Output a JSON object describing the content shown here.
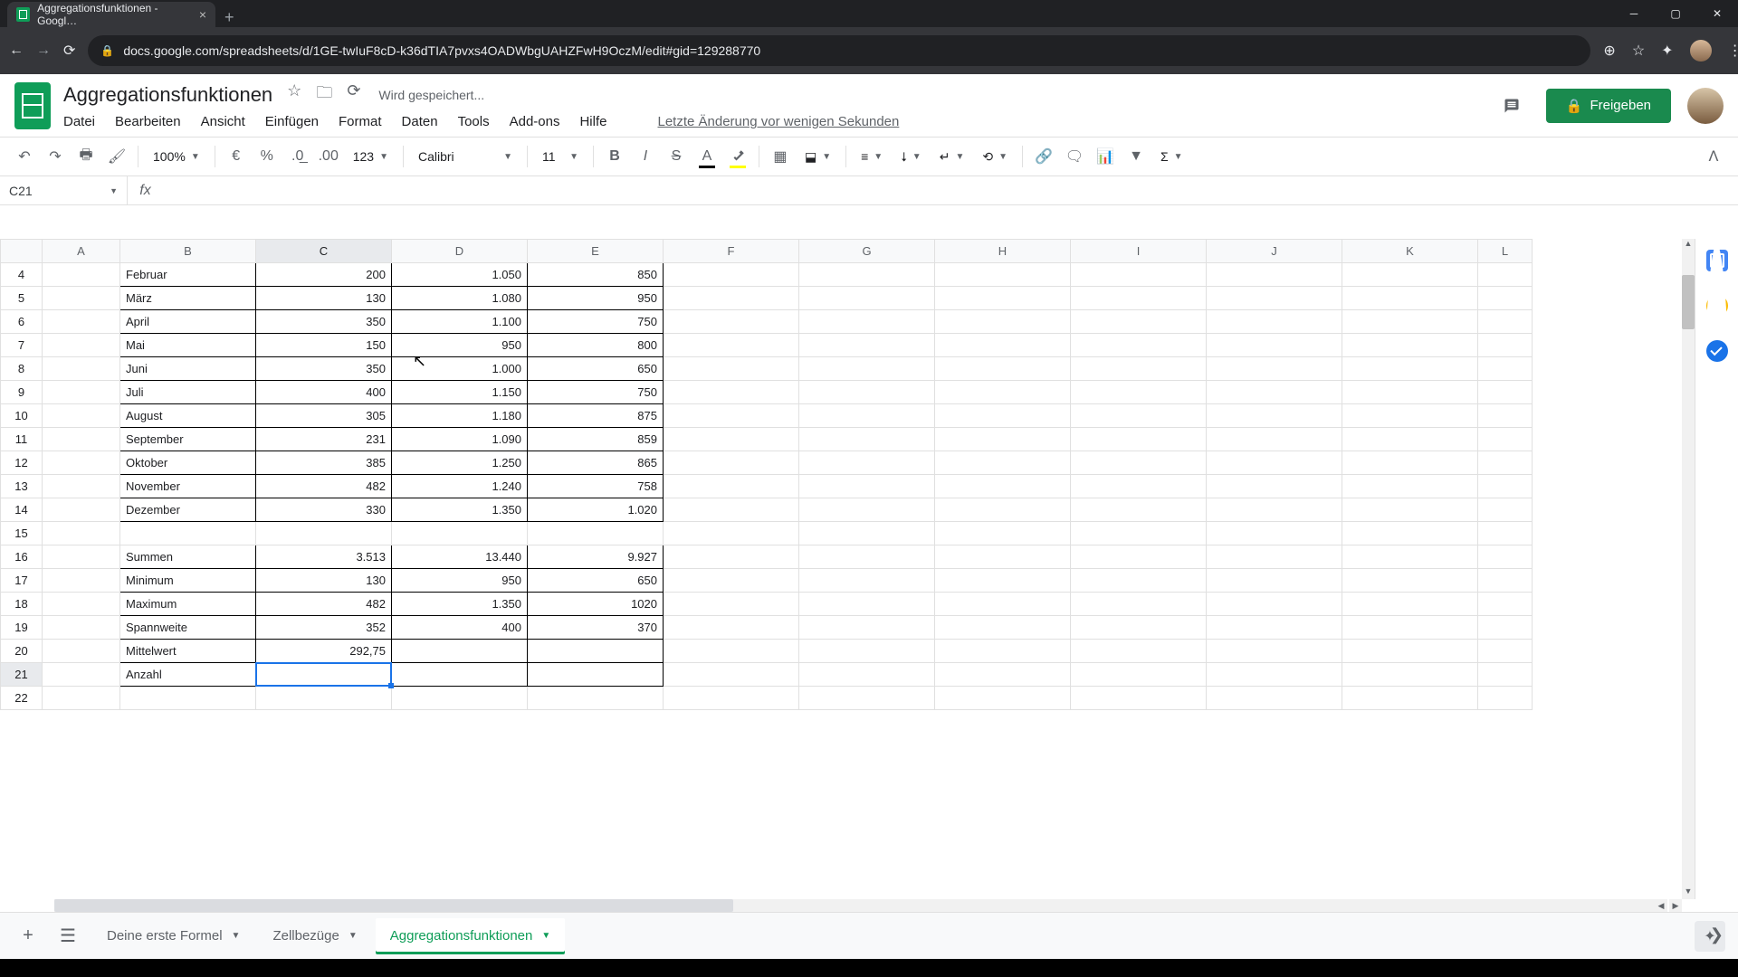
{
  "browser": {
    "tab_title": "Aggregationsfunktionen - Googl…",
    "url": "docs.google.com/spreadsheets/d/1GE-twIuF8cD-k36dTIA7pvxs4OADWbgUAHZFwH9OczM/edit#gid=129288770"
  },
  "doc": {
    "title": "Aggregationsfunktionen",
    "saving": "Wird gespeichert...",
    "last_edit": "Letzte Änderung vor wenigen Sekunden"
  },
  "menus": {
    "file": "Datei",
    "edit": "Bearbeiten",
    "view": "Ansicht",
    "insert": "Einfügen",
    "format": "Format",
    "data": "Daten",
    "tools": "Tools",
    "addons": "Add-ons",
    "help": "Hilfe"
  },
  "share": {
    "label": "Freigeben"
  },
  "toolbar": {
    "zoom": "100%",
    "currency": "€",
    "percent": "%",
    "dec_dec": ".0",
    "inc_dec": ".00",
    "more_formats": "123",
    "font": "Calibri",
    "font_size": "11"
  },
  "namebox": "C21",
  "formula": "",
  "columns": [
    "A",
    "B",
    "C",
    "D",
    "E",
    "F",
    "G",
    "H",
    "I",
    "J",
    "K",
    "L"
  ],
  "rows": [
    {
      "n": 4,
      "b": "Februar",
      "c": "200",
      "d": "1.050",
      "e": "850",
      "border": true
    },
    {
      "n": 5,
      "b": "März",
      "c": "130",
      "d": "1.080",
      "e": "950",
      "border": true
    },
    {
      "n": 6,
      "b": "April",
      "c": "350",
      "d": "1.100",
      "e": "750",
      "border": true
    },
    {
      "n": 7,
      "b": "Mai",
      "c": "150",
      "d": "950",
      "e": "800",
      "border": true
    },
    {
      "n": 8,
      "b": "Juni",
      "c": "350",
      "d": "1.000",
      "e": "650",
      "border": true
    },
    {
      "n": 9,
      "b": "Juli",
      "c": "400",
      "d": "1.150",
      "e": "750",
      "border": true
    },
    {
      "n": 10,
      "b": "August",
      "c": "305",
      "d": "1.180",
      "e": "875",
      "border": true
    },
    {
      "n": 11,
      "b": "September",
      "c": "231",
      "d": "1.090",
      "e": "859",
      "border": true
    },
    {
      "n": 12,
      "b": "Oktober",
      "c": "385",
      "d": "1.250",
      "e": "865",
      "border": true
    },
    {
      "n": 13,
      "b": "November",
      "c": "482",
      "d": "1.240",
      "e": "758",
      "border": true
    },
    {
      "n": 14,
      "b": "Dezember",
      "c": "330",
      "d": "1.350",
      "e": "1.020",
      "border": true
    },
    {
      "n": 15
    },
    {
      "n": 16,
      "b": "Summen",
      "c": "3.513",
      "d": "13.440",
      "e": "9.927",
      "border": true,
      "yellow": true
    },
    {
      "n": 17,
      "b": "Minimum",
      "c": "130",
      "d": "950",
      "e": "650",
      "border": true,
      "yellow": true
    },
    {
      "n": 18,
      "b": "Maximum",
      "c": "482",
      "d": "1.350",
      "e": "1020",
      "border": true,
      "yellow": true
    },
    {
      "n": 19,
      "b": "Spannweite",
      "c": "352",
      "d": "400",
      "e": "370",
      "border": true,
      "yellow": true
    },
    {
      "n": 20,
      "b": "Mittelwert",
      "c": "292,75",
      "d": "",
      "e": "",
      "border": true,
      "yellow": true
    },
    {
      "n": 21,
      "b": "Anzahl",
      "c": "",
      "d": "",
      "e": "",
      "border": true,
      "yellow": true,
      "selected_c": true
    },
    {
      "n": 22
    }
  ],
  "sheets": {
    "add": "+",
    "tabs": [
      {
        "label": "Deine erste Formel",
        "active": false
      },
      {
        "label": "Zellbezüge",
        "active": false
      },
      {
        "label": "Aggregationsfunktionen",
        "active": true
      }
    ]
  }
}
